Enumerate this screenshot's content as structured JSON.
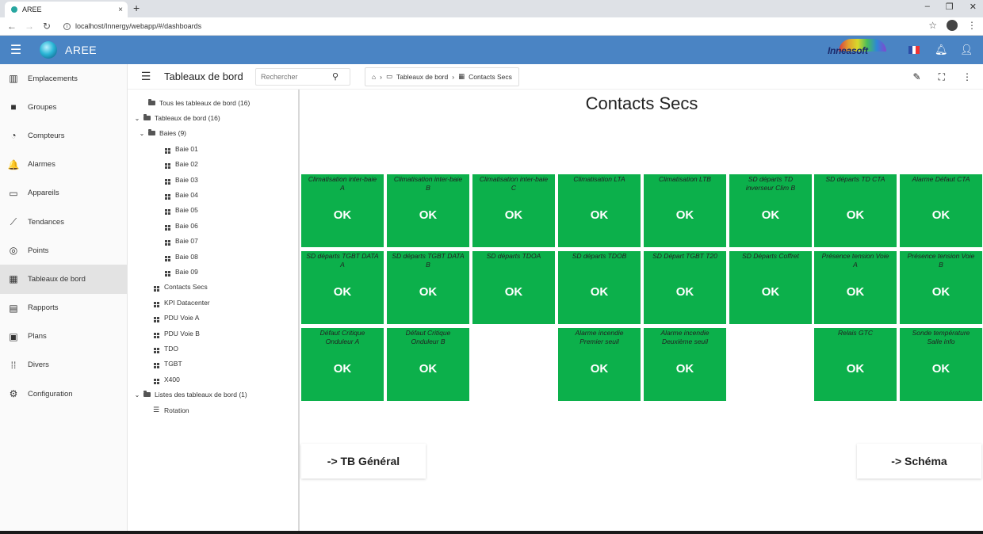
{
  "browser": {
    "tab_title": "AREE",
    "tab_close": "×",
    "new_tab": "+",
    "url": "localhost/Innergy/webapp/#/dashboards",
    "win_minimize": "–",
    "win_restore": "❐",
    "win_close": "✕"
  },
  "app": {
    "title": "AREE",
    "brand": "Inneasoft"
  },
  "sidebar": {
    "items": [
      {
        "label": "Emplacements",
        "icon": "building-icon",
        "glyph": "▥"
      },
      {
        "label": "Groupes",
        "icon": "folder-icon",
        "glyph": "■"
      },
      {
        "label": "Compteurs",
        "icon": "meter-icon",
        "glyph": "◔"
      },
      {
        "label": "Alarmes",
        "icon": "bell-icon",
        "glyph": "🔔"
      },
      {
        "label": "Appareils",
        "icon": "devices-icon",
        "glyph": "▭"
      },
      {
        "label": "Tendances",
        "icon": "trend-icon",
        "glyph": "⟋"
      },
      {
        "label": "Points",
        "icon": "points-icon",
        "glyph": "◎"
      },
      {
        "label": "Tableaux de bord",
        "icon": "dashboard-icon",
        "glyph": "▦"
      },
      {
        "label": "Rapports",
        "icon": "report-icon",
        "glyph": "▤"
      },
      {
        "label": "Plans",
        "icon": "plan-icon",
        "glyph": "▣"
      },
      {
        "label": "Divers",
        "icon": "apps-icon",
        "glyph": "⁞⁞"
      },
      {
        "label": "Configuration",
        "icon": "gear-icon",
        "glyph": "⚙"
      }
    ],
    "active_index": 7
  },
  "toolbar": {
    "title": "Tableaux de bord",
    "search_placeholder": "Rechercher",
    "breadcrumb": {
      "level1": "Tableaux de bord",
      "level2": "Contacts Secs"
    }
  },
  "tree": {
    "all": "Tous les tableaux de bord (16)",
    "root": "Tableaux de bord (16)",
    "baies_group": "Baies (9)",
    "baies": [
      "Baie 01",
      "Baie 02",
      "Baie 03",
      "Baie 04",
      "Baie 05",
      "Baie 06",
      "Baie 07",
      "Baie 08",
      "Baie 09"
    ],
    "dashboards": [
      "Contacts Secs",
      "KPI Datacenter",
      "PDU Voie A",
      "PDU Voie B",
      "TDO",
      "TGBT",
      "X400"
    ],
    "lists_group": "Listes des tableaux de bord (1)",
    "lists": [
      "Rotation"
    ]
  },
  "dashboard": {
    "title": "Contacts Secs",
    "state_color": "#0cb04b",
    "tiles": [
      {
        "label": "Climatisation inter-baie\nA",
        "state": "OK"
      },
      {
        "label": "Climatisation inter-baie\nB",
        "state": "OK"
      },
      {
        "label": "Climatisation inter-baie\nC",
        "state": "OK"
      },
      {
        "label": "Climatisation LTA",
        "state": "OK"
      },
      {
        "label": "Climatisation LTB",
        "state": "OK"
      },
      {
        "label": "SD départs TD\ninverseur Clim B",
        "state": "OK"
      },
      {
        "label": "SD départs TD CTA",
        "state": "OK"
      },
      {
        "label": "Alarme Défaut CTA",
        "state": "OK"
      },
      {
        "label": "SD départs TGBT DATA\nA",
        "state": "OK"
      },
      {
        "label": "SD départs TGBT DATA\nB",
        "state": "OK"
      },
      {
        "label": "SD départs TDOA",
        "state": "OK"
      },
      {
        "label": "SD départs TDOB",
        "state": "OK"
      },
      {
        "label": "SD Départ TGBT T20",
        "state": "OK"
      },
      {
        "label": "SD Départs Coffret",
        "state": "OK"
      },
      {
        "label": "Présence tension Voie\nA",
        "state": "OK"
      },
      {
        "label": "Présence tension Voie\nB",
        "state": "OK"
      },
      {
        "label": "Défaut Critique\nOnduleur A",
        "state": "OK"
      },
      {
        "label": "Défaut Critique\nOnduleur B",
        "state": "OK"
      },
      {
        "label": "Alarme incendie\nPremier seuil",
        "state": "OK"
      },
      {
        "label": "Alarme incendie\nDeuxième seuil",
        "state": "OK"
      },
      {
        "label": "Relais GTC",
        "state": "OK"
      },
      {
        "label": "Sonde température\nSalle info",
        "state": "OK"
      }
    ],
    "buttons": {
      "left": "-> TB Général",
      "right": "-> Schéma"
    }
  }
}
